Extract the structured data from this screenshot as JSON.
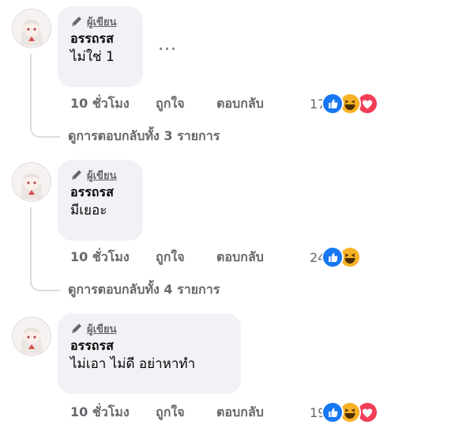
{
  "colors": {
    "bubble_bg": "#f0f2f5",
    "secondary_text": "#65676b",
    "like_blue": "#1877f2",
    "haha_yellow": "#f7b125",
    "love_red": "#f33e58"
  },
  "comments": [
    {
      "avatar_icon": "anime-avatar-icon",
      "badge_icon": "pencil-icon",
      "badge_label": "ผู้เขียน",
      "author": "อรรถรส",
      "text": "ไม่ใช่ 1",
      "more_label": "...",
      "time": "10 ชั่วโมง",
      "like_label": "ถูกใจ",
      "reply_label": "ตอบกลับ",
      "reaction_count": "17",
      "reactions": [
        "like-icon",
        "haha-icon",
        "love-icon"
      ],
      "view_replies": "ดูการตอบกลับทั้ง 3 รายการ"
    },
    {
      "avatar_icon": "anime-avatar-icon",
      "badge_icon": "pencil-icon",
      "badge_label": "ผู้เขียน",
      "author": "อรรถรส",
      "text": "มีเยอะ",
      "time": "10 ชั่วโมง",
      "like_label": "ถูกใจ",
      "reply_label": "ตอบกลับ",
      "reaction_count": "24",
      "reactions": [
        "like-icon",
        "haha-icon"
      ],
      "view_replies": "ดูการตอบกลับทั้ง 4 รายการ"
    },
    {
      "avatar_icon": "anime-avatar-icon",
      "badge_icon": "pencil-icon",
      "badge_label": "ผู้เขียน",
      "author": "อรรถรส",
      "text": "ไม่เอา ไม่ดี อย่าหาทำ",
      "time": "10 ชั่วโมง",
      "like_label": "ถูกใจ",
      "reply_label": "ตอบกลับ",
      "reaction_count": "19",
      "reactions": [
        "like-icon",
        "haha-icon",
        "love-icon"
      ]
    }
  ]
}
